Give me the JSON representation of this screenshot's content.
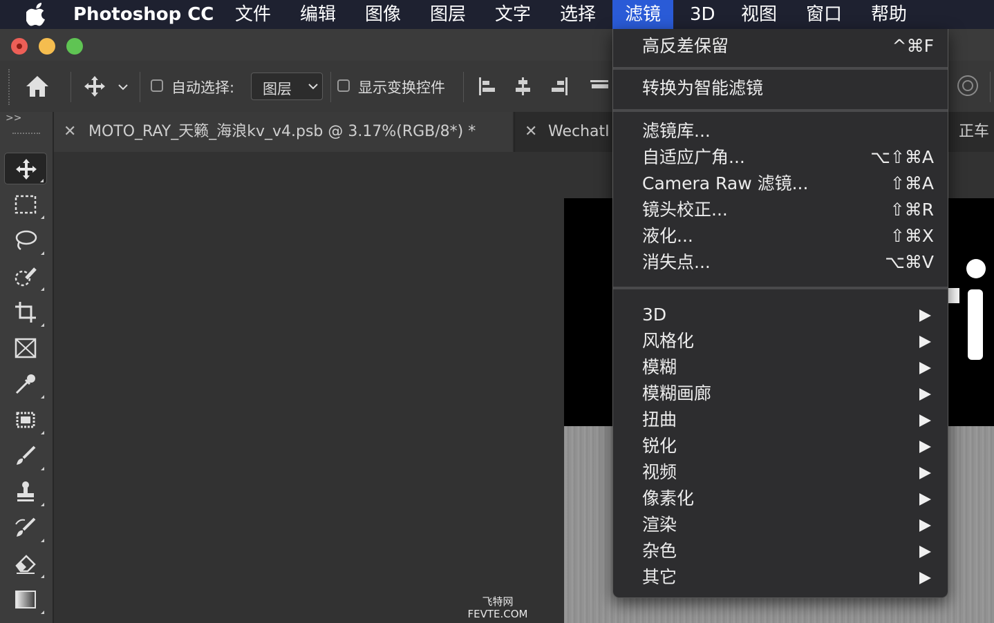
{
  "menubar": {
    "app_name": "Photoshop CC",
    "items": [
      "文件",
      "编辑",
      "图像",
      "图层",
      "文字",
      "选择",
      "滤镜",
      "3D",
      "视图",
      "窗口",
      "帮助"
    ],
    "active_item": "滤镜"
  },
  "options_bar": {
    "auto_select_label": "自动选择:",
    "layer_select_value": "图层",
    "show_transform_label": "显示变换控件"
  },
  "tabs": [
    {
      "title": "MOTO_RAY_天籁_海浪kv_v4.psb @ 3.17%(RGB/8*) *"
    },
    {
      "title": "WechatI"
    },
    {
      "title": "正车"
    }
  ],
  "filter_menu": {
    "items": [
      {
        "label": "高反差保留",
        "shortcut": "^⌘F"
      },
      {
        "label": "转换为智能滤镜",
        "shortcut": ""
      },
      {
        "label": "滤镜库...",
        "shortcut": ""
      },
      {
        "label": "自适应广角...",
        "shortcut": "⌥⇧⌘A"
      },
      {
        "label": "Camera Raw 滤镜...",
        "shortcut": "⇧⌘A"
      },
      {
        "label": "镜头校正...",
        "shortcut": "⇧⌘R"
      },
      {
        "label": "液化...",
        "shortcut": "⇧⌘X"
      },
      {
        "label": "消失点...",
        "shortcut": "⌥⌘V"
      }
    ],
    "submenus": [
      "3D",
      "风格化",
      "模糊",
      "模糊画廊",
      "扭曲",
      "锐化",
      "视频",
      "像素化",
      "渲染",
      "杂色",
      "其它"
    ]
  },
  "watermark": {
    "line1": "飞特网",
    "line2": "FEVTE.COM"
  },
  "toolbar_icons": [
    "move-icon",
    "marquee-icon",
    "lasso-icon",
    "quick-select-icon",
    "crop-icon",
    "frame-icon",
    "eyedropper-icon",
    "spot-heal-icon",
    "brush-icon",
    "stamp-icon",
    "history-brush-icon",
    "eraser-icon",
    "gradient-icon"
  ],
  "colors": {
    "menubar_bg": "#1e2130",
    "menu_highlight": "#2a5bd7",
    "panel_bg": "#323232",
    "menu_bg": "#2d2d2f",
    "traffic_close": "#ed5f57",
    "traffic_min": "#f5bd4f",
    "traffic_max": "#5fc453"
  }
}
